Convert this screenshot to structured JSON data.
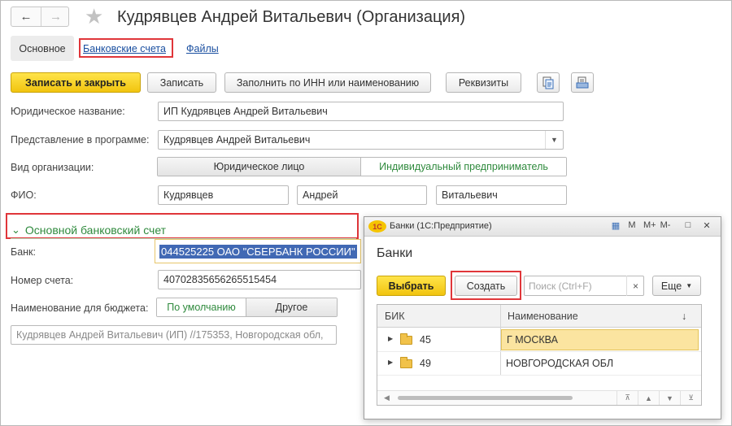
{
  "header": {
    "title": "Кудрявцев Андрей Витальевич (Организация)",
    "back_icon": "arrow-left-icon",
    "forward_icon": "arrow-right-icon",
    "favorite_icon": "star-icon"
  },
  "tabs": {
    "main": "Основное",
    "bank_accounts": "Банковские счета",
    "files": "Файлы"
  },
  "toolbar": {
    "save_close": "Записать и закрыть",
    "save": "Записать",
    "fill_inn": "Заполнить по ИНН или наименованию",
    "requisites": "Реквизиты"
  },
  "form": {
    "legal_name_label": "Юридическое название:",
    "legal_name_value": "ИП Кудрявцев Андрей Витальевич",
    "display_label": "Представление в программе:",
    "display_value": "Кудрявцев Андрей Витальевич",
    "org_type_label": "Вид организации:",
    "org_type_options": [
      "Юридическое лицо",
      "Индивидуальный предприниматель"
    ],
    "fio_label": "ФИО:",
    "last_name": "Кудрявцев",
    "first_name": "Андрей",
    "middle_name": "Витальевич"
  },
  "bank_section": {
    "title": "Основной банковский счет",
    "bank_label": "Банк:",
    "bank_value": "044525225 ОАО \"СБЕРБАНК РОССИИ\"",
    "account_label": "Номер счета:",
    "account_value": "40702835656265515454",
    "budget_label": "Наименование для бюджета:",
    "budget_options": [
      "По умолчанию",
      "Другое"
    ],
    "budget_value": "Кудрявцев Андрей Витальевич (ИП) //175353, Новгородская обл,"
  },
  "dialog": {
    "caption": "Банки (1С:Предприятие)",
    "logo": "1С",
    "heading": "Банки",
    "select_btn": "Выбрать",
    "create_btn": "Создать",
    "search_placeholder": "Поиск (Ctrl+F)",
    "clear": "×",
    "more_btn": "Еще",
    "columns": [
      "БИК",
      "Наименование"
    ],
    "sort_arrow": "↓",
    "rows": [
      {
        "bik": "45",
        "name": "Г МОСКВА"
      },
      {
        "bik": "49",
        "name": "НОВГОРОДСКАЯ ОБЛ"
      }
    ]
  }
}
